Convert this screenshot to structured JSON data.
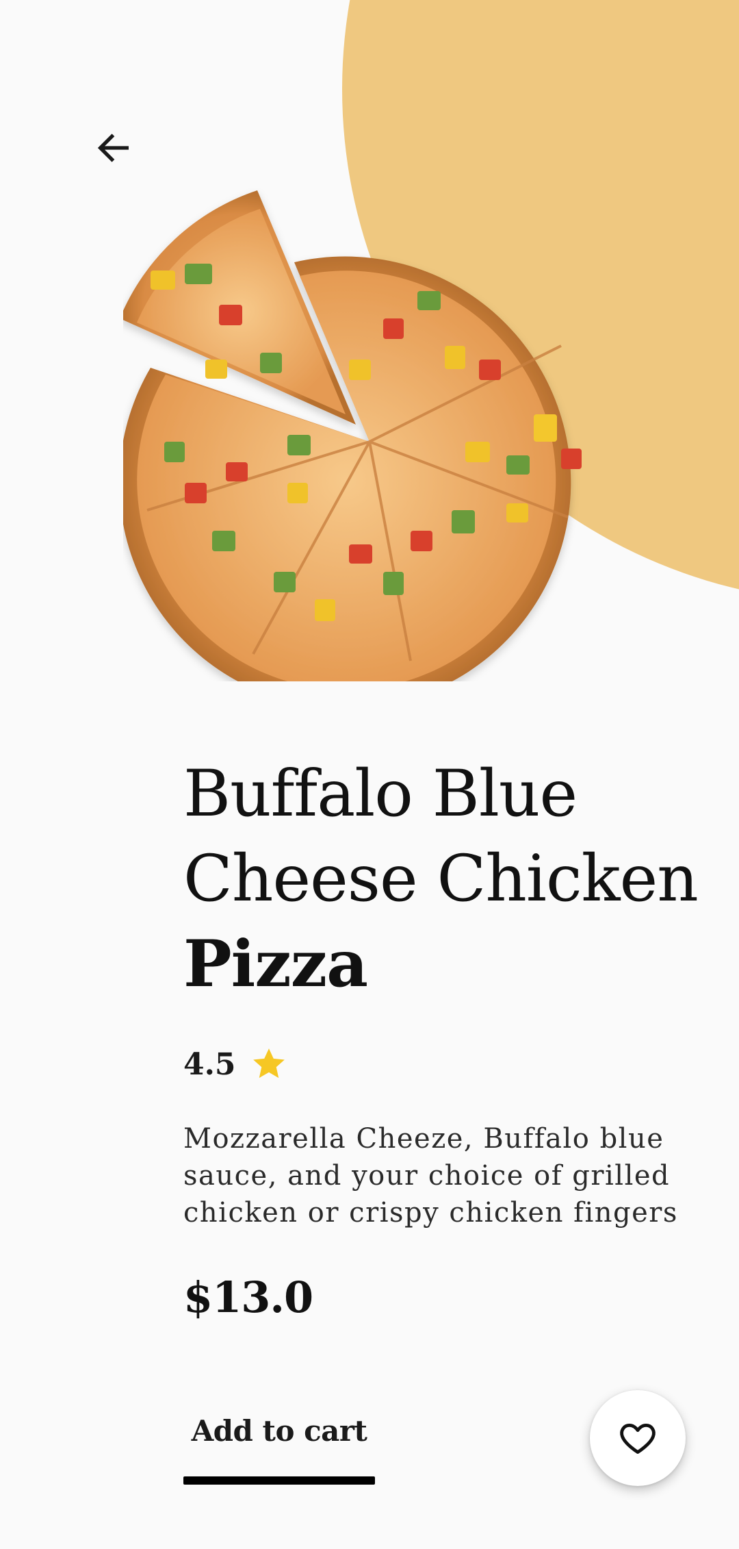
{
  "colors": {
    "background": "#fafafa",
    "accent_blob": "#efc880",
    "star": "#f6c724",
    "text": "#111111"
  },
  "header": {
    "back_icon": "arrow-left-icon"
  },
  "product": {
    "image": "pizza-image",
    "title_lines": [
      "Buffalo Blue",
      "Cheese Chicken",
      "Pizza"
    ],
    "rating": "4.5",
    "rating_icon": "star-icon",
    "description": "Mozzarella Cheeze, Buffalo blue\nsauce, and your choice of grilled\nchicken or crispy chicken fingers",
    "price": "$13.0"
  },
  "actions": {
    "add_to_cart_label": "Add to cart",
    "favorite_icon": "heart-outline-icon"
  }
}
